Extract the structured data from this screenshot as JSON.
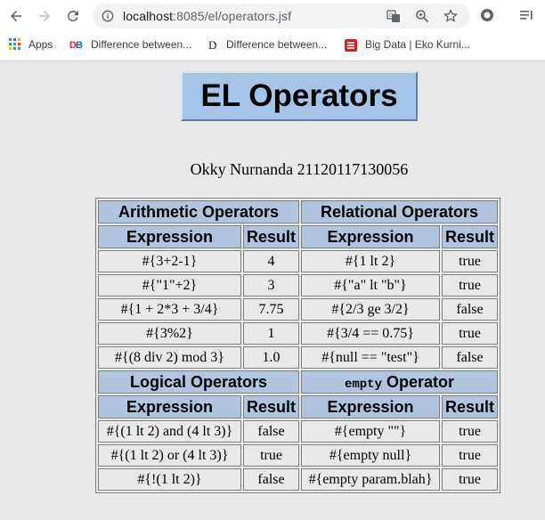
{
  "browser": {
    "url_host": "localhost",
    "url_rest": ":8085/el/operators.jsf",
    "bookmarks": [
      {
        "label": "Apps"
      },
      {
        "label": "Difference between..."
      },
      {
        "label": "Difference between..."
      },
      {
        "label": "Big Data | Eko Kurni..."
      }
    ]
  },
  "page": {
    "title": "EL Operators",
    "author": "Okky Nurnanda 21120117130056"
  },
  "table": {
    "sections": {
      "arithmetic": "Arithmetic Operators",
      "relational": "Relational Operators",
      "logical": "Logical Operators",
      "empty_code": "empty",
      "empty_rest": " Operator"
    },
    "headers": {
      "expression": "Expression",
      "result": "Result"
    },
    "top_rows": [
      {
        "a_expr": "#{3+2-1}",
        "a_res": "4",
        "r_expr": "#{1 lt 2}",
        "r_res": "true"
      },
      {
        "a_expr": "#{\"1\"+2}",
        "a_res": "3",
        "r_expr": "#{\"a\" lt \"b\"}",
        "r_res": "true"
      },
      {
        "a_expr": "#{1 + 2*3 + 3/4}",
        "a_res": "7.75",
        "r_expr": "#{2/3 ge 3/2}",
        "r_res": "false"
      },
      {
        "a_expr": "#{3%2}",
        "a_res": "1",
        "r_expr": "#{3/4 == 0.75}",
        "r_res": "true"
      },
      {
        "a_expr": "#{(8 div 2) mod 3}",
        "a_res": "1.0",
        "r_expr": "#{null == \"test\"}",
        "r_res": "false"
      }
    ],
    "bottom_rows": [
      {
        "l_expr": "#{(1 lt 2) and (4 lt 3)}",
        "l_res": "false",
        "e_expr": "#{empty \"\"}",
        "e_res": "true"
      },
      {
        "l_expr": "#{(1 lt 2) or (4 lt 3)}",
        "l_res": "true",
        "e_expr": "#{empty null}",
        "e_res": "true"
      },
      {
        "l_expr": "#{!(1 lt 2)}",
        "l_res": "false",
        "e_expr": "#{empty param.blah}",
        "e_res": "true"
      }
    ]
  }
}
